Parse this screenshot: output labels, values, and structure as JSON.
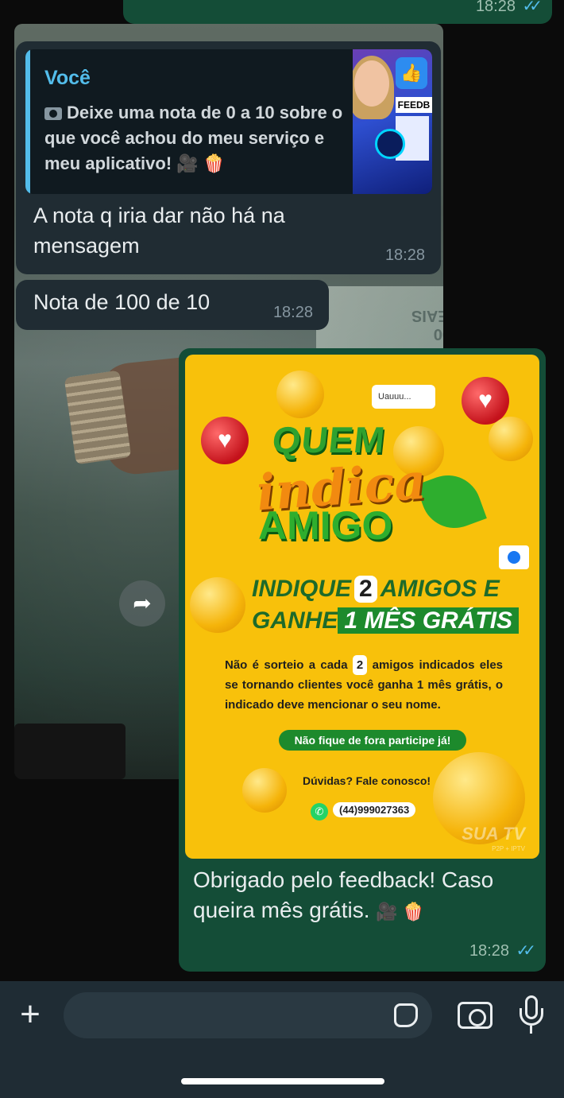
{
  "top_outgoing": {
    "time": "18:28",
    "ticks": "✓✓"
  },
  "reply_bubble": {
    "quoted_author": "Você",
    "quoted_text": "Deixe  uma nota de 0 a 10 sobre o que você achou do meu serviço e meu aplicativo!",
    "quoted_emoji": "🎥 🍿",
    "thumbnail_label": "FEEDB",
    "message": "A nota q iria dar não há na mensagem",
    "time": "18:28"
  },
  "second_bubble": {
    "message": "Nota de 100 de 10",
    "time": "18:28"
  },
  "background_photo": {
    "money_text": "100 REAIS"
  },
  "promo_image": {
    "bubble_text": "Uauuu...",
    "headline_1": "QUEM",
    "headline_2": "indica",
    "headline_3": "AMIGO",
    "line_1_a": "INDIQUE",
    "line_1_num": "2",
    "line_1_b": "AMIGOS E",
    "line_2_a": "GANHE",
    "line_2_b": "1 MÊS GRÁTIS",
    "body_1": "Não é sorteio a cada",
    "body_num": "2",
    "body_2": "amigos indicados eles se tornando clientes",
    "body_bold": "você ganha 1 mês grátis",
    "body_3": ", o indicado deve mencionar o seu nome.",
    "pill": "Não fique de fora participe já!",
    "duvidas": "Dúvidas? Fale conosco!",
    "phone": "(44)999027363",
    "brand": "SUA TV",
    "brand_sub": "P2P + IPTV"
  },
  "outgoing_caption": {
    "text": "Obrigado pelo feedback! Caso queira mês grátis.",
    "emoji": "🎥 🍿",
    "time": "18:28",
    "ticks": "✓✓"
  },
  "input": {
    "placeholder": ""
  },
  "colors": {
    "incoming_bubble": "#202c33",
    "outgoing_bubble": "#144d37",
    "accent": "#53bdeb",
    "promo_yellow": "#f8c10b",
    "promo_green": "#1d8a2c"
  },
  "icons": [
    "camera-mini-icon",
    "forward-icon",
    "plus-icon",
    "sticker-icon",
    "camera-icon",
    "microphone-icon",
    "whatsapp-icon"
  ]
}
